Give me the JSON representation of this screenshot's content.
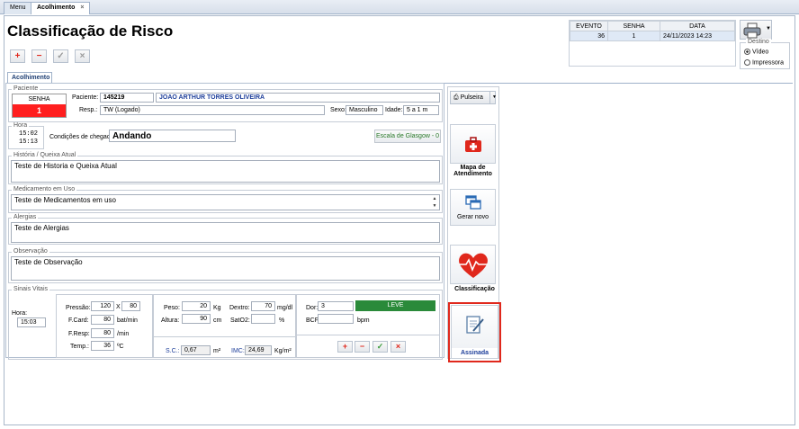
{
  "tabs": {
    "menu": "Menu",
    "acolhimento": "Acolhimento",
    "close": "×"
  },
  "title": "Classificação de Risco",
  "toolbar": {
    "add": "+",
    "remove": "−",
    "confirm": "✓",
    "cancel": "×"
  },
  "event_table": {
    "headers": [
      "EVENTO",
      "SENHA",
      "DATA"
    ],
    "row": [
      "36",
      "1",
      "24/11/2023 14:23"
    ]
  },
  "destino": {
    "label": "Destino",
    "options": [
      "Vídeo",
      "Impressora"
    ],
    "selected": "Vídeo"
  },
  "subtab": "Acolhimento",
  "paciente": {
    "group": "Paciente",
    "senha_label": "SENHA",
    "senha_value": "1",
    "paciente_label": "Paciente:",
    "codigo": "145219",
    "nome": "JOAO ARTHUR TORRES OLIVEIRA",
    "resp_label": "Resp.:",
    "resp_value": "TW (Logado)",
    "sexo_label": "Sexo:",
    "sexo_value": "Masculino",
    "idade_label": "Idade:",
    "idade_value": "5 a 1 m"
  },
  "hora": {
    "group": "Hora",
    "line1": "15:02",
    "line2": "15:13"
  },
  "chegada": {
    "label": "Condições de chegada:",
    "value": "Andando"
  },
  "glasgow": "Escala de Glasgow - 0",
  "historia": {
    "group": "História / Queixa Atual",
    "value": "Teste de Historia e Queixa Atual"
  },
  "medicamento": {
    "group": "Medicamento em Uso",
    "value": "Teste de Medicamentos em uso"
  },
  "alergias": {
    "group": "Alergias",
    "value": "Teste de Alergias"
  },
  "observacao": {
    "group": "Observação",
    "value": "Teste de Observação"
  },
  "sinais": {
    "group": "Sinais Vitais",
    "hora_label": "Hora:",
    "hora_value": "15:03",
    "pressao_label": "Pressão:",
    "pressao_a": "120",
    "pressao_x": "X",
    "pressao_b": "80",
    "fcard_label": "F.Card:",
    "fcard_value": "80",
    "fcard_unit": "bat/min",
    "fresp_label": "F.Resp:",
    "fresp_value": "80",
    "fresp_unit": "/min",
    "temp_label": "Temp.:",
    "temp_value": "36",
    "temp_unit": "ºC",
    "peso_label": "Peso:",
    "peso_value": "20",
    "peso_unit": "Kg",
    "dextro_label": "Dextro:",
    "dextro_value": "70",
    "dextro_unit": "mg/dl",
    "altura_label": "Altura:",
    "altura_value": "90",
    "altura_unit": "cm",
    "sat_label": "SatO2:",
    "sat_value": "",
    "sat_unit": "%",
    "sc_label": "S.C.:",
    "sc_value": "0,67",
    "sc_unit": "m²",
    "imc_label": "IMC:",
    "imc_value": "24,69",
    "imc_unit": "Kg/m²",
    "dor_label": "Dor:",
    "dor_value": "3",
    "dor_level": "LEVE",
    "bcf_label": "BCF:",
    "bcf_value": "",
    "bcf_unit": "bpm"
  },
  "side": {
    "pulseira": "Pulseira",
    "mapa": "Mapa de Atendimento",
    "gerar": "Gerar novo",
    "classificacao": "Classificação",
    "assinada": "Assinada"
  },
  "colors": {
    "accent_red": "#e0281c",
    "highlight": "#e0281c",
    "leve_green": "#2a8a3a",
    "senha_red": "#ff1f1f"
  }
}
